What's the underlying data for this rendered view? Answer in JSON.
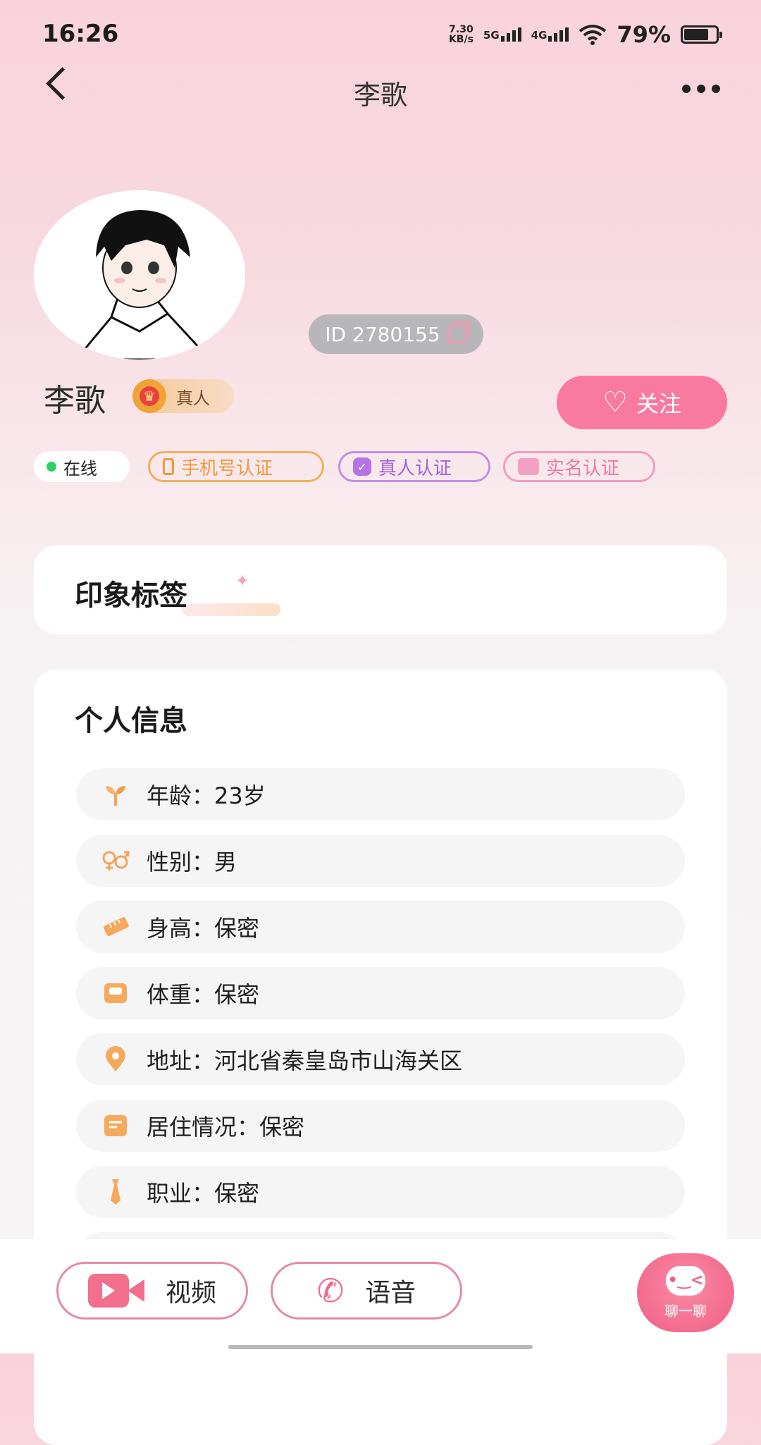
{
  "status_bar": {
    "time": "16:26",
    "speed_value": "7.30",
    "speed_unit": "KB/s",
    "net1": "5G",
    "net2": "4G",
    "battery": "79%"
  },
  "nav": {
    "title": "李歌",
    "back_icon": "chevron-left-icon",
    "more_icon": "more-dots-icon"
  },
  "profile": {
    "id_label": "ID 2780155",
    "name": "李歌",
    "real_badge": "真人",
    "follow_label": "关注"
  },
  "tags": {
    "online": "在线",
    "phone": "手机号认证",
    "real": "真人认证",
    "realname": "实名认证"
  },
  "impression": {
    "title": "印象标签"
  },
  "personal_info": {
    "title": "个人信息",
    "rows": [
      {
        "text": "年龄：23岁",
        "icon": "sprout-icon"
      },
      {
        "text": "性别：男",
        "icon": "gender-icon"
      },
      {
        "text": "身高：保密",
        "icon": "ruler-icon"
      },
      {
        "text": "体重：保密",
        "icon": "scale-icon"
      },
      {
        "text": "地址：河北省秦皇岛市山海关区",
        "icon": "location-pin-icon"
      },
      {
        "text": "居住情况：保密",
        "icon": "house-icon"
      },
      {
        "text": "职业：保密",
        "icon": "tie-icon"
      }
    ]
  },
  "bottom": {
    "video_label": "视频",
    "voice_label": "语音",
    "chat_label": "聊一聊"
  },
  "colors": {
    "accent_pink": "#f97aa0",
    "online_green": "#2ed062",
    "phone_orange": "#f09a3a",
    "real_purple": "#a262d6",
    "realname_pink": "#ea79a8"
  }
}
